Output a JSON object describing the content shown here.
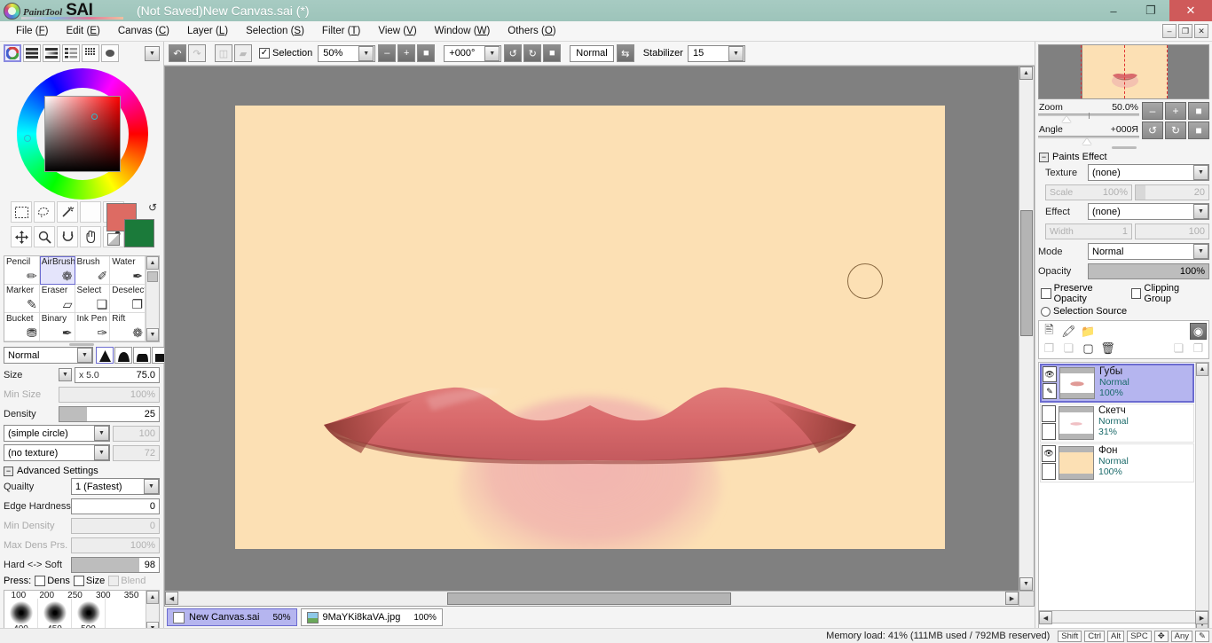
{
  "app": {
    "logo_paint": "PaintTool",
    "logo_sai": "SAI",
    "title": "(Not Saved)New Canvas.sai (*)"
  },
  "window_controls": {
    "minimize": "–",
    "maximize": "❐",
    "close": "✕"
  },
  "menu": {
    "items": [
      {
        "label": "File",
        "key": "F"
      },
      {
        "label": "Edit",
        "key": "E"
      },
      {
        "label": "Canvas",
        "key": "C"
      },
      {
        "label": "Layer",
        "key": "L"
      },
      {
        "label": "Selection",
        "key": "S"
      },
      {
        "label": "Filter",
        "key": "T"
      },
      {
        "label": "View",
        "key": "V"
      },
      {
        "label": "Window",
        "key": "W"
      },
      {
        "label": "Others",
        "key": "O"
      }
    ],
    "win_buttons": [
      "–",
      "❐",
      "✕"
    ]
  },
  "options_bar": {
    "undo_icon": "undo-icon",
    "redo_icon": "redo-icon",
    "flip_icon": "flip-icon",
    "selection_icon": "selection-icon",
    "selection_checkbox_label": "Selection",
    "selection_checked": true,
    "zoom_value": "50%",
    "zoom_out_label": "–",
    "zoom_in_label": "+",
    "zoom_reset_label": "■",
    "angle_value": "+000°",
    "rotate_ccw_label": "↺",
    "rotate_cw_label": "↻",
    "rotate_reset_label": "■",
    "normal_label": "Normal",
    "mirror_icon": "mirror-icon",
    "stabilizer_label": "Stabilizer",
    "stabilizer_value": "15"
  },
  "color_panel": {
    "modes": [
      "wheel-icon",
      "rgb-sliders-icon",
      "hsv-sliders-icon",
      "gradient-icon",
      "palette-icon",
      "scratch-icon"
    ],
    "active_mode": 0,
    "menu_arrow": "▼",
    "foreground_color": "#dd6b63",
    "background_color": "#1b7a3a",
    "swap_icon": "swap-colors-icon"
  },
  "tools": {
    "select_icons": [
      "marquee-select-icon",
      "lasso-select-icon",
      "magic-wand-icon",
      "empty-slot",
      "empty-slot"
    ],
    "nav_icons": [
      "move-icon",
      "zoom-icon",
      "rotate-icon",
      "pan-hand-icon",
      "eyedropper-icon"
    ],
    "grid": [
      {
        "name": "Pencil",
        "glyph": "✏",
        "selected": false
      },
      {
        "name": "AirBrush",
        "glyph": "❁",
        "selected": true
      },
      {
        "name": "Brush",
        "glyph": "✐",
        "selected": false
      },
      {
        "name": "Water",
        "glyph": "✒",
        "selected": false
      },
      {
        "name": "Marker",
        "glyph": "✎",
        "selected": false
      },
      {
        "name": "Eraser",
        "glyph": "▱",
        "selected": false
      },
      {
        "name": "Select",
        "glyph": "❑",
        "selected": false
      },
      {
        "name": "Deselect",
        "glyph": "❐",
        "selected": false
      },
      {
        "name": "Bucket",
        "glyph": "⛃",
        "selected": false
      },
      {
        "name": "Binary",
        "glyph": "✒",
        "selected": false
      },
      {
        "name": "Ink Pen",
        "glyph": "✑",
        "selected": false
      },
      {
        "name": "Rift",
        "glyph": "❁",
        "selected": false
      }
    ]
  },
  "brush_settings": {
    "blend_mode": "Normal",
    "shape_icons": [
      "shape-soft-icon",
      "shape-round-icon",
      "shape-flat-icon",
      "shape-square-icon"
    ],
    "shape_selected": 0,
    "size_label": "Size",
    "size_multiplier": "x 5.0",
    "size_value": "75.0",
    "min_size_label": "Min Size",
    "min_size_value": "100%",
    "density_label": "Density",
    "density_value": "25",
    "shape_name": "(simple circle)",
    "shape_value": "100",
    "texture_name": "(no texture)",
    "texture_value": "72"
  },
  "advanced_settings": {
    "header": "Advanced Settings",
    "collapse_glyph": "−",
    "quality_label": "Quailty",
    "quality_value": "1 (Fastest)",
    "edge_hardness_label": "Edge Hardness",
    "edge_hardness_value": "0",
    "min_density_label": "Min Density",
    "min_density_value": "0",
    "max_dens_prs_label": "Max Dens Prs.",
    "max_dens_prs_value": "100%",
    "hard_soft_label": "Hard <-> Soft",
    "hard_soft_value": "98",
    "press_label": "Press:",
    "press_dens": "Dens",
    "press_size": "Size",
    "press_blend": "Blend"
  },
  "brush_sizes": {
    "top_row": [
      "100",
      "200",
      "250",
      "300",
      "350"
    ],
    "bottom_row": [
      "400",
      "450",
      "500"
    ]
  },
  "canvas": {
    "background_color": "#fce0b4",
    "workspace_color": "#808080",
    "brush_cursor": "brush-cursor-circle"
  },
  "navigator": {
    "zoom_label": "Zoom",
    "zoom_value": "50.0%",
    "angle_label": "Angle",
    "angle_value": "+000Я",
    "buttons": [
      "–",
      "+",
      "■",
      "↺",
      "↻",
      "■"
    ]
  },
  "paints_effect": {
    "header": "Paints Effect",
    "collapse_glyph": "−",
    "texture_label": "Texture",
    "texture_value": "(none)",
    "scale_label": "Scale",
    "scale_value": "100%",
    "scale_amount": "20",
    "effect_label": "Effect",
    "effect_value": "(none)",
    "width_label": "Width",
    "width_value": "1",
    "width_amount": "100"
  },
  "layer_props": {
    "mode_label": "Mode",
    "mode_value": "Normal",
    "opacity_label": "Opacity",
    "opacity_value": "100%",
    "preserve_opacity": "Preserve Opacity",
    "clipping_group": "Clipping Group",
    "selection_source": "Selection Source"
  },
  "layer_toolbar": {
    "row1": [
      "new-layer-icon",
      "new-linework-layer-icon",
      "new-folder-icon",
      "layer-mask-icon"
    ],
    "row2": [
      "merge-down-icon",
      "merge-selected-icon",
      "clear-layer-icon",
      "delete-layer-icon",
      "transfer-down-icon",
      "add-below-icon"
    ]
  },
  "layers": [
    {
      "name": "Губы",
      "mode": "Normal",
      "opacity": "100%",
      "visible": true,
      "selected": true,
      "thumb_color": "#e09a96"
    },
    {
      "name": "Скетч",
      "mode": "Normal",
      "opacity": "31%",
      "visible": false,
      "selected": false,
      "thumb_color": "#f0c0c4"
    },
    {
      "name": "Фон",
      "mode": "Normal",
      "opacity": "100%",
      "visible": true,
      "selected": false,
      "thumb_color": "#fce0b4"
    }
  ],
  "doc_tabs": [
    {
      "label": "New Canvas.sai",
      "zoom": "50%",
      "active": true,
      "icon": "document-icon"
    },
    {
      "label": "9MaYKi8kaVA.jpg",
      "zoom": "100%",
      "active": false,
      "icon": "image-icon"
    }
  ],
  "status_bar": {
    "memory_text": "Memory load: 41% (111MB used / 792MB reserved)",
    "keys": [
      "Shift",
      "Ctrl",
      "Alt",
      "SPC",
      "✥",
      "Any"
    ],
    "pen_icon": "pen-icon"
  }
}
